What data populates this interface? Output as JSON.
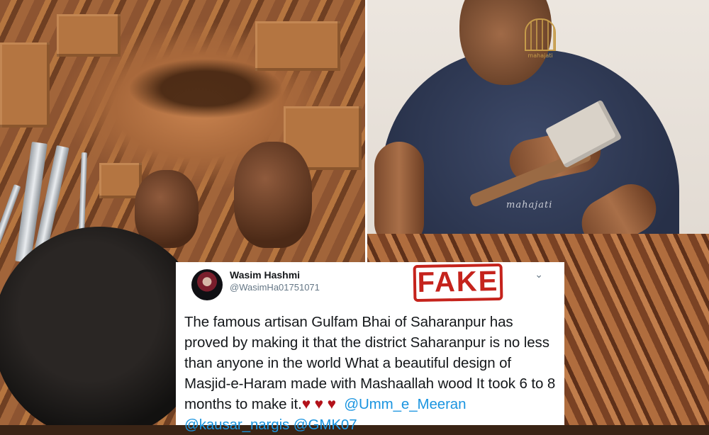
{
  "tweet": {
    "display_name": "Wasim Hashmi",
    "handle": "@WasimHa01751071",
    "text": "The famous artisan Gulfam Bhai of Saharanpur has proved by making it that the district Saharanpur is no less than anyone in the world What a beautiful design of Masjid-e-Haram made with Mashaallah wood It took 6 to 8 months to make it.",
    "hearts": [
      "♥",
      "♥",
      "♥"
    ],
    "mentions": [
      "@Umm_e_Meeran",
      "@kausar_nargis",
      "@GMK07"
    ],
    "menu_icon": "chevron-down-icon"
  },
  "stamp": {
    "label": "FAKE",
    "color": "#c5231c"
  },
  "photo_right": {
    "logo_text": "mahajati",
    "shirt_text": "mahajati"
  },
  "colors": {
    "mention": "#1b95e0",
    "heart": "#b3121a",
    "handle": "#657786"
  }
}
